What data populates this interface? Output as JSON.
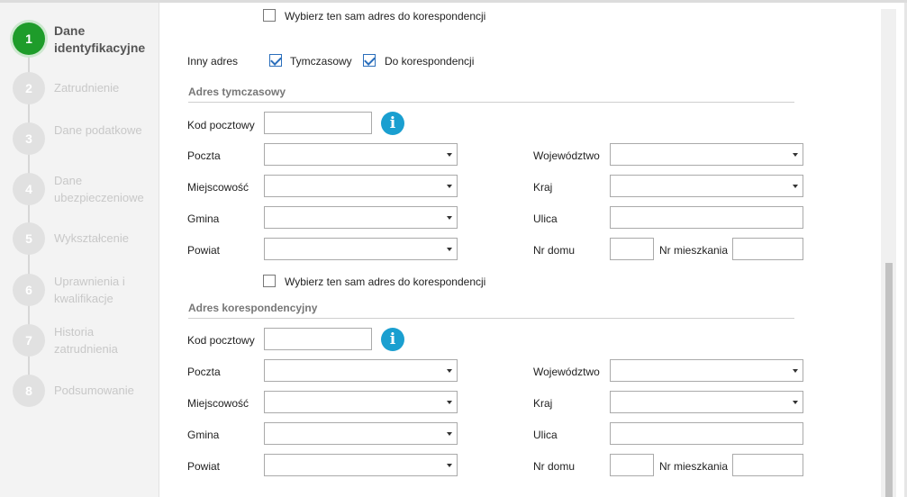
{
  "steps": [
    {
      "number": "1",
      "label": "Dane identyfikacyjne",
      "active": true
    },
    {
      "number": "2",
      "label": "Zatrudnienie"
    },
    {
      "number": "3",
      "label": "Dane podatkowe"
    },
    {
      "number": "4",
      "label": "Dane ubezpieczeniowe"
    },
    {
      "number": "5",
      "label": "Wykształcenie"
    },
    {
      "number": "6",
      "label": "Uprawnienia i kwalifikacje"
    },
    {
      "number": "7",
      "label": "Historia zatrudnienia"
    },
    {
      "number": "8",
      "label": "Podsumowanie"
    }
  ],
  "top_same_address": {
    "label": "Wybierz ten sam adres do korespondencji",
    "checked": false
  },
  "other_address": {
    "label": "Inny adres",
    "temporary": {
      "label": "Tymczasowy",
      "checked": true
    },
    "correspondence": {
      "label": "Do korespondencji",
      "checked": true
    }
  },
  "temporary_address": {
    "title": "Adres tymczasowy",
    "postal_code": {
      "label": "Kod pocztowy",
      "value": ""
    },
    "post_office": {
      "label": "Poczta",
      "value": ""
    },
    "town": {
      "label": "Miejscowość",
      "value": ""
    },
    "commune": {
      "label": "Gmina",
      "value": ""
    },
    "district": {
      "label": "Powiat",
      "value": ""
    },
    "voivodeship": {
      "label": "Województwo",
      "value": ""
    },
    "country": {
      "label": "Kraj",
      "value": ""
    },
    "street": {
      "label": "Ulica",
      "value": ""
    },
    "house_no": {
      "label": "Nr domu",
      "value": ""
    },
    "apartment_no": {
      "label": "Nr mieszkania",
      "value": ""
    },
    "same_address": {
      "label": "Wybierz ten sam adres do korespondencji",
      "checked": false
    }
  },
  "correspondence_address": {
    "title": "Adres korespondencyjny",
    "postal_code": {
      "label": "Kod pocztowy",
      "value": ""
    },
    "post_office": {
      "label": "Poczta",
      "value": ""
    },
    "town": {
      "label": "Miejscowość",
      "value": ""
    },
    "commune": {
      "label": "Gmina",
      "value": ""
    },
    "district": {
      "label": "Powiat",
      "value": ""
    },
    "voivodeship": {
      "label": "Województwo",
      "value": ""
    },
    "country": {
      "label": "Kraj",
      "value": ""
    },
    "street": {
      "label": "Ulica",
      "value": ""
    },
    "house_no": {
      "label": "Nr domu",
      "value": ""
    },
    "apartment_no": {
      "label": "Nr mieszkania",
      "value": ""
    }
  },
  "info_icon_glyph": "i",
  "colors": {
    "active_step": "#1e9c2a",
    "info_icon": "#1a9fd0",
    "checkbox_accent": "#2a6ebb"
  }
}
